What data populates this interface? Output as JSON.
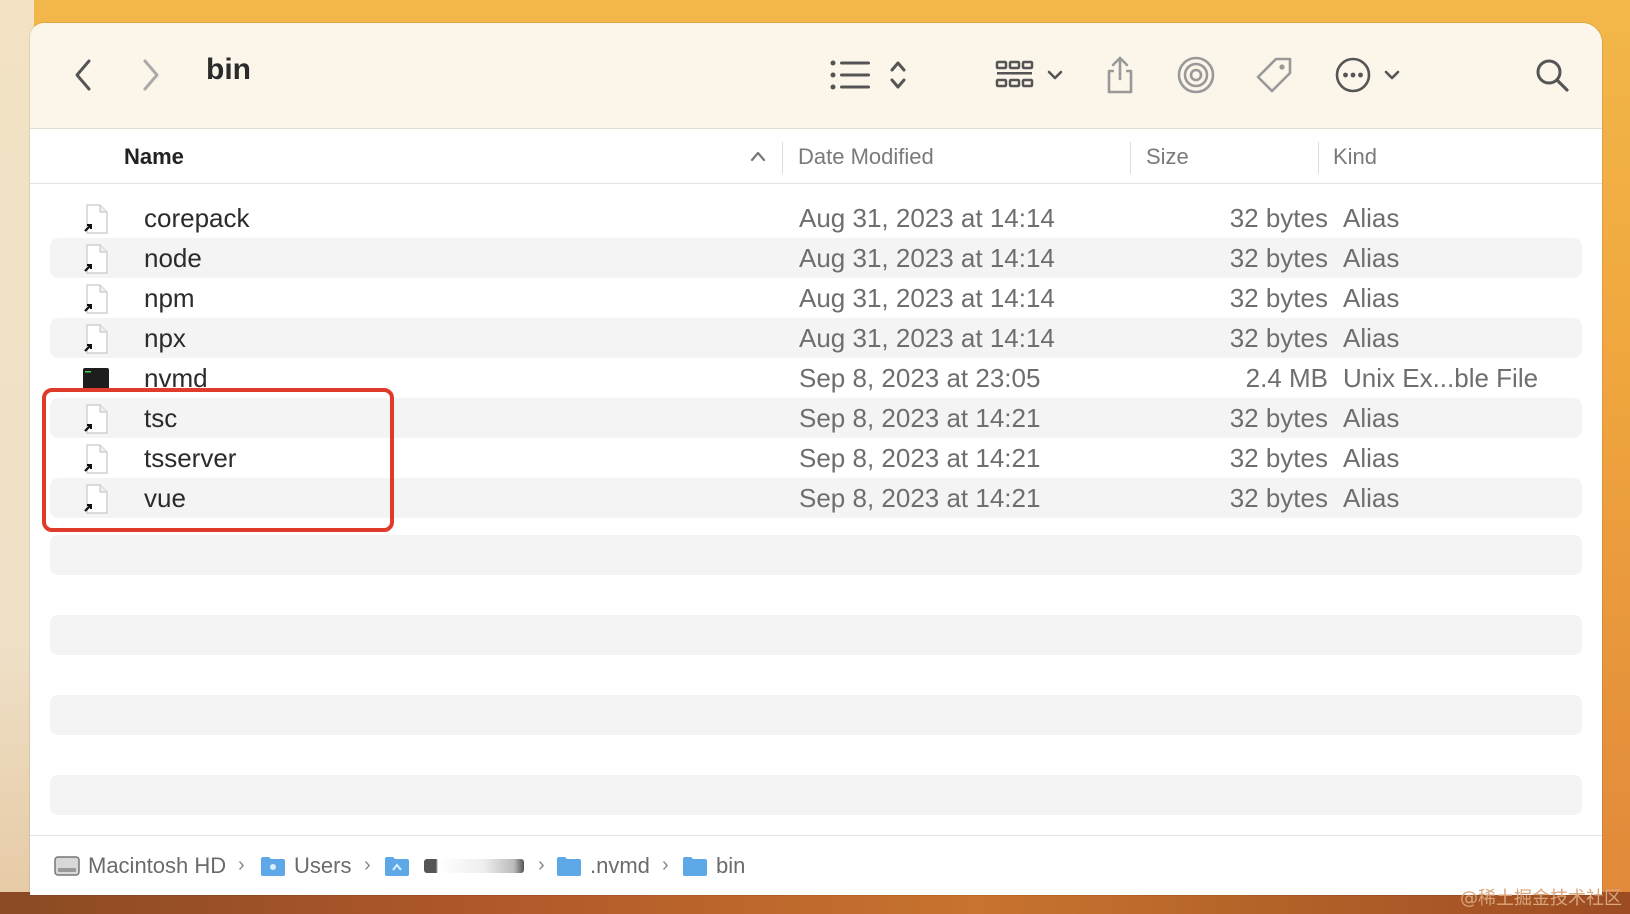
{
  "window": {
    "title": "bin"
  },
  "toolbar": {
    "back_icon": "chevron-left-icon",
    "forward_icon": "chevron-right-icon",
    "view_list_icon": "list-view-icon",
    "view_grid_icon": "grid-view-icon",
    "share_icon": "share-icon",
    "airdrop_icon": "airdrop-icon",
    "tag_icon": "tag-icon",
    "more_icon": "ellipsis-circle-icon",
    "search_icon": "search-icon"
  },
  "columns": {
    "name": "Name",
    "date_modified": "Date Modified",
    "size": "Size",
    "kind": "Kind"
  },
  "files": [
    {
      "name": "corepack",
      "date": "Aug 31, 2023 at 14:14",
      "size": "32 bytes",
      "kind": "Alias",
      "icon": "alias-file-icon"
    },
    {
      "name": "node",
      "date": "Aug 31, 2023 at 14:14",
      "size": "32 bytes",
      "kind": "Alias",
      "icon": "alias-file-icon"
    },
    {
      "name": "npm",
      "date": "Aug 31, 2023 at 14:14",
      "size": "32 bytes",
      "kind": "Alias",
      "icon": "alias-file-icon"
    },
    {
      "name": "npx",
      "date": "Aug 31, 2023 at 14:14",
      "size": "32 bytes",
      "kind": "Alias",
      "icon": "alias-file-icon"
    },
    {
      "name": "nvmd",
      "date": "Sep 8, 2023 at 23:05",
      "size": "2.4 MB",
      "kind": "Unix Ex...ble File",
      "icon": "terminal-executable-icon"
    },
    {
      "name": "tsc",
      "date": "Sep 8, 2023 at 14:21",
      "size": "32 bytes",
      "kind": "Alias",
      "icon": "alias-file-icon"
    },
    {
      "name": "tsserver",
      "date": "Sep 8, 2023 at 14:21",
      "size": "32 bytes",
      "kind": "Alias",
      "icon": "alias-file-icon"
    },
    {
      "name": "vue",
      "date": "Sep 8, 2023 at 14:21",
      "size": "32 bytes",
      "kind": "Alias",
      "icon": "alias-file-icon"
    }
  ],
  "pathbar": {
    "items": [
      "Macintosh HD",
      "Users",
      "",
      ".nvmd",
      "bin"
    ]
  },
  "watermark": "@稀土掘金技术社区",
  "colors": {
    "highlight": "#e03a2a",
    "folder": "#5ea8e8",
    "toolbar_bg": "#fcf5ea"
  }
}
